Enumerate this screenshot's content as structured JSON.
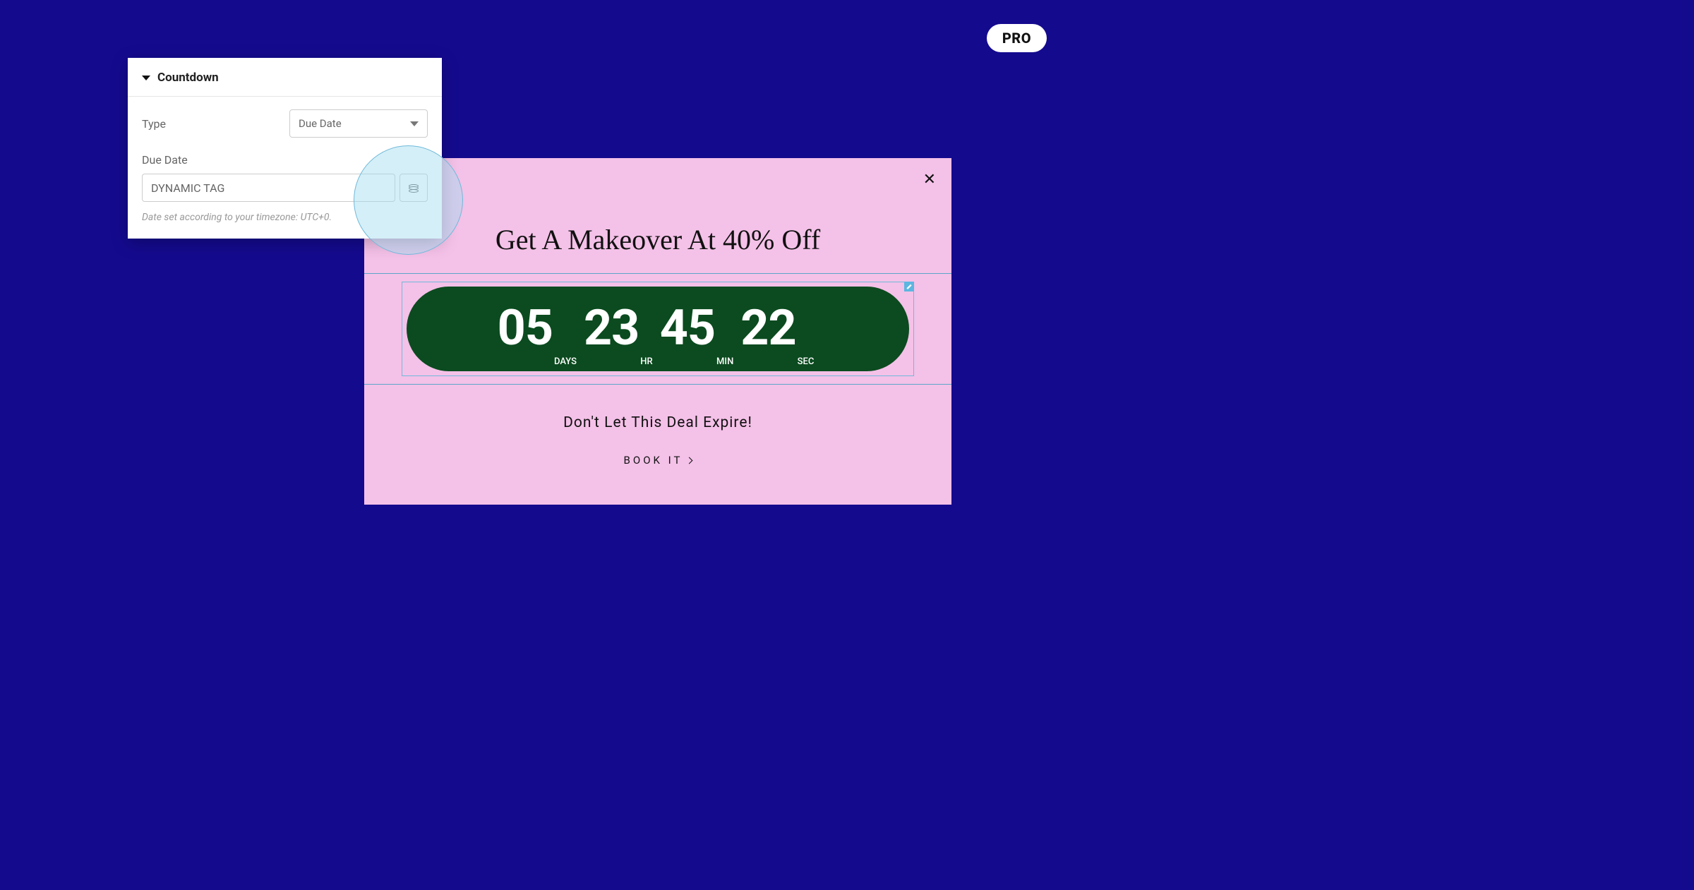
{
  "badge": {
    "label": "PRO"
  },
  "panel": {
    "title": "Countdown",
    "type_label": "Type",
    "type_value": "Due Date",
    "due_label": "Due Date",
    "tag_value": "DYNAMIC TAG",
    "helper": "Date set according to your timezone: UTC+0."
  },
  "popup": {
    "title": "Get A Makeover At 40% Off",
    "subtitle": "Don't Let This Deal Expire!",
    "cta": "BOOK IT",
    "countdown": {
      "days": "05",
      "days_label": "DAYS",
      "hours": "23",
      "hours_label": "HR",
      "minutes": "45",
      "minutes_label": "MIN",
      "seconds": "22",
      "seconds_label": "SEC"
    }
  }
}
